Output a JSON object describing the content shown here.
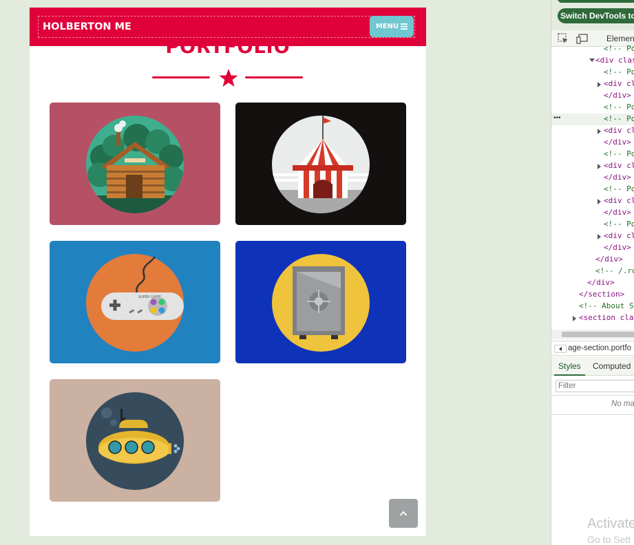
{
  "navbar": {
    "brand": "HOLBERTON ME",
    "menu_label": "MENU"
  },
  "section": {
    "title": "PORTFOLIO"
  },
  "portfolio": {
    "items": [
      {
        "name": "cabin",
        "background": "#b65165",
        "circle": "#3fae8f"
      },
      {
        "name": "circus",
        "background": "#141010",
        "circle": "#e9eceb"
      },
      {
        "name": "game",
        "background": "#2182c0",
        "circle": "#e37b3b"
      },
      {
        "name": "safe",
        "background": "#0f33b8",
        "circle": "#f0c33c"
      },
      {
        "name": "submarine",
        "background": "#cbb1a2",
        "circle": "#364c5d"
      }
    ]
  },
  "game_badge": "SUPER GAME",
  "colors": {
    "accent": "#e0003a",
    "menu_button": "#6fc7cf",
    "scroll_button": "#9ea2a2"
  },
  "devtools": {
    "switch_label": "Switch DevTools to D",
    "elements_tab": "Elements",
    "code_lines": [
      {
        "indent": 3,
        "text": "<!-- Port",
        "kind": "comment"
      },
      {
        "indent": 2,
        "text": "<div clas",
        "kind": "tag",
        "arrow": "down"
      },
      {
        "indent": 3,
        "text": "<!-- Po",
        "kind": "comment"
      },
      {
        "indent": 3,
        "text": "<div cl",
        "kind": "tag",
        "arrow": "right"
      },
      {
        "indent": 3,
        "text": "</div>",
        "kind": "tag"
      },
      {
        "indent": 3,
        "text": "<!-- Po",
        "kind": "comment"
      },
      {
        "indent": 3,
        "text": "<!-- Po",
        "kind": "comment",
        "selected": true
      },
      {
        "indent": 3,
        "text": "<div cl",
        "kind": "tag",
        "arrow": "right"
      },
      {
        "indent": 3,
        "text": "</div>",
        "kind": "tag"
      },
      {
        "indent": 3,
        "text": "<!-- Po",
        "kind": "comment"
      },
      {
        "indent": 3,
        "text": "<div cl",
        "kind": "tag",
        "arrow": "right"
      },
      {
        "indent": 3,
        "text": "</div>",
        "kind": "tag"
      },
      {
        "indent": 3,
        "text": "<!-- Po",
        "kind": "comment"
      },
      {
        "indent": 3,
        "text": "<div cl",
        "kind": "tag",
        "arrow": "right"
      },
      {
        "indent": 3,
        "text": "</div>",
        "kind": "tag"
      },
      {
        "indent": 3,
        "text": "<!-- Po",
        "kind": "comment"
      },
      {
        "indent": 3,
        "text": "<div cl",
        "kind": "tag",
        "arrow": "right"
      },
      {
        "indent": 3,
        "text": "</div>",
        "kind": "tag"
      },
      {
        "indent": 2,
        "text": "</div>",
        "kind": "tag"
      },
      {
        "indent": 2,
        "text": "<!-- /.ro",
        "kind": "comment"
      },
      {
        "indent": 1,
        "text": "</div>",
        "kind": "tag"
      },
      {
        "indent": 0,
        "text": "</section>",
        "kind": "tag"
      },
      {
        "indent": 0,
        "text": "<!-- About Se",
        "kind": "comment"
      },
      {
        "indent": 0,
        "text": "<section clas",
        "kind": "tag",
        "arrow": "right"
      }
    ],
    "breadcrumb": "age-section.portfo",
    "tabs": {
      "styles": "Styles",
      "computed": "Computed"
    },
    "filter_placeholder": "Filter",
    "no_match": "No ma"
  },
  "watermark": {
    "line1": "Activate",
    "line2": "Go to Sett"
  }
}
